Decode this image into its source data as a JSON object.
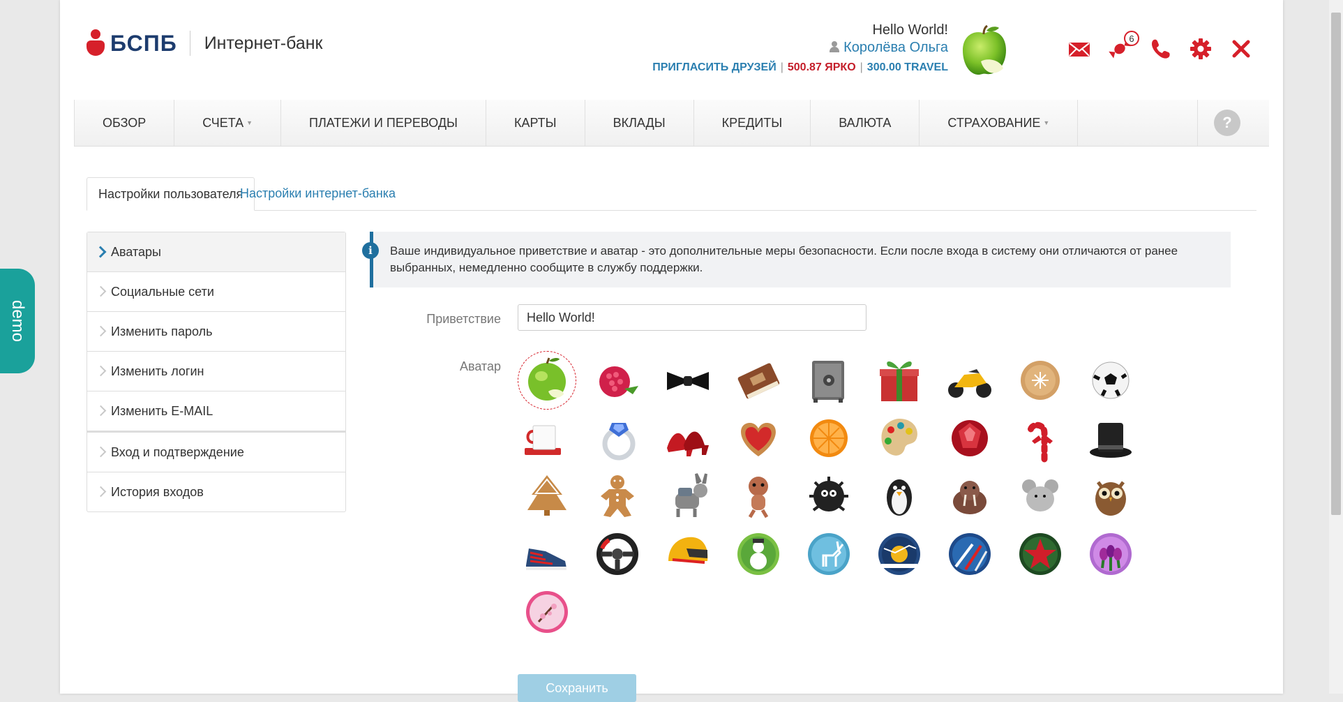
{
  "brand": {
    "name": "БСПБ",
    "subtitle": "Интернет-банк",
    "color": "#d6202a"
  },
  "user": {
    "greeting": "Hello World!",
    "name": "Королёва Ольга",
    "invite": "ПРИГЛАСИТЬ ДРУЗЕЙ",
    "yarko": "500.87 ЯРКО",
    "travel": "300.00 TRAVEL"
  },
  "header_icons": [
    {
      "name": "mail-icon"
    },
    {
      "name": "candy-icon",
      "badge": "6"
    },
    {
      "name": "phone-icon"
    },
    {
      "name": "gear-icon"
    },
    {
      "name": "close-icon"
    }
  ],
  "nav": {
    "items": [
      "ОБЗОР",
      "СЧЕТА",
      "ПЛАТЕЖИ И ПЕРЕВОДЫ",
      "КАРТЫ",
      "ВКЛАДЫ",
      "КРЕДИТЫ",
      "ВАЛЮТА",
      "СТРАХОВАНИЕ"
    ],
    "help": "?"
  },
  "tabs": {
    "user_settings": "Настройки пользователя",
    "bank_settings": "Настройки интернет-банка"
  },
  "sidebar": {
    "items": [
      "Аватары",
      "Социальные сети",
      "Изменить пароль",
      "Изменить логин",
      "Изменить E-MAIL",
      "Вход и подтверждение",
      "История входов"
    ]
  },
  "info": {
    "text": "Ваше индивидуальное приветствие и аватар - это дополнительные меры безопасности. Если после входа в систему они отличаются от ранее выбранных, немедленно сообщите в службу поддержки."
  },
  "form": {
    "greeting_label": "Приветствие",
    "greeting_value": "Hello World!",
    "avatar_label": "Аватар",
    "save": "Сохранить"
  },
  "avatars": [
    "apple",
    "raspberry",
    "bow-tie",
    "book",
    "safe",
    "gift",
    "motorcycle",
    "cookie",
    "soccer-ball",
    "mug",
    "ring",
    "high-heels",
    "heart-cookie",
    "orange",
    "palette",
    "ruby",
    "candy-cane",
    "top-hat",
    "tree-cookie",
    "gingerbread-man",
    "donkey",
    "squirrel",
    "hedgehog",
    "penguin",
    "walrus",
    "mouse",
    "owl",
    "sneaker",
    "steering-wheel",
    "helmet",
    "snowman",
    "deer",
    "santa-sleigh",
    "airplanes",
    "red-star",
    "tulips",
    "sakura"
  ],
  "demo": "demo"
}
